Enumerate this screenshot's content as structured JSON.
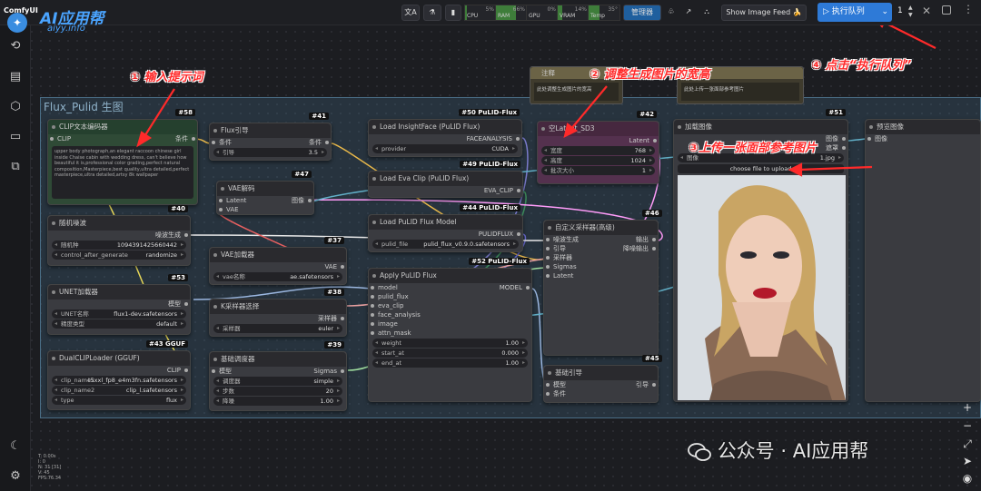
{
  "brand": {
    "comfy": "ComfyUI",
    "logo_text": "AI应用帮",
    "url": "aiyy.info",
    "sub": "se"
  },
  "topbar": {
    "translate": "文A",
    "monitor": {
      "cpu": {
        "label": "CPU",
        "val": "5%"
      },
      "ram": {
        "label": "RAM",
        "val": "66%"
      },
      "gpu": {
        "label": "GPU",
        "val": "0%"
      },
      "vram": {
        "label": "VRAM",
        "val": "14%"
      },
      "temp": {
        "label": "Temp",
        "val": "35°"
      }
    },
    "manager": "管理器",
    "show_feed": "Show Image Feed 🍌",
    "queue": "执行队列",
    "queue_count": "1"
  },
  "group_title": "Flux_Pulid 生图",
  "annotations": {
    "a1": "① 输入提示词",
    "a2": "② 调整生成图片的宽高",
    "a3": "③上传一张面部参考图片",
    "a4": "④ 点击“执行队列”"
  },
  "notes": [
    {
      "title": "注释",
      "body": "此处调整生成图片的宽高"
    },
    {
      "title": "",
      "body": "此处上传一张面部参考图片"
    }
  ],
  "nodes": {
    "clip": {
      "badge": "#58",
      "title": "CLIP文本编码器",
      "in": "CLIP",
      "out": "条件",
      "text": "upper body photograph,an elegant raccoon chinese girl inside Chaise cabin with wedding dress, can't believe how beautiful it is,professional color grading,perfect natural composition,Masterpiece,best quality,ultra detailed,perfect masterpiece,ultra detailed,artsy 8k wallpaper"
    },
    "guide": {
      "badge": "#41",
      "title": "Flux引导",
      "in": "条件",
      "out": "条件",
      "w_label": "引导",
      "w_val": "3.5"
    },
    "vaedec": {
      "badge": "#47",
      "title": "VAE解码",
      "in1": "Latent",
      "in2": "VAE",
      "out": "图像"
    },
    "noise": {
      "badge": "#40",
      "title": "随机噪波",
      "out": "噪波生成",
      "w1_label": "随机种",
      "w1_val": "1094391425660442",
      "w2_label": "control_after_generate",
      "w2_val": "randomize"
    },
    "vaeload": {
      "badge": "#37",
      "title": "VAE加载器",
      "out": "VAE",
      "w_label": "vae名称",
      "w_val": "ae.safetensors"
    },
    "unet": {
      "badge": "#53",
      "title": "UNET加载器",
      "out": "模型",
      "w1_label": "UNET名称",
      "w1_val": "flux1-dev.safetensors",
      "w2_label": "精度类型",
      "w2_val": "default"
    },
    "ksel": {
      "badge": "#38",
      "title": "K采样器选择",
      "out": "采样器",
      "w_label": "采样器",
      "w_val": "euler"
    },
    "dual": {
      "badge": "#43 GGUF",
      "title": "DualCLIPLoader (GGUF)",
      "out": "CLIP",
      "w1_label": "clip_name1",
      "w1_val": "t5xxl_fp8_e4m3fn.safetensors",
      "w2_label": "clip_name2",
      "w2_val": "clip_l.safetensors",
      "w3_label": "type",
      "w3_val": "flux"
    },
    "sched": {
      "badge": "#39",
      "title": "基础调度器",
      "in": "模型",
      "out": "Sigmas",
      "w1_label": "调度器",
      "w1_val": "simple",
      "w2_label": "步数",
      "w2_val": "20",
      "w3_label": "降噪",
      "w3_val": "1.00"
    },
    "insight": {
      "badge": "#50 PuLID-Flux",
      "title": "Load InsightFace (PuLID Flux)",
      "out": "FACEANALYSIS",
      "w_label": "provider",
      "w_val": "CUDA"
    },
    "eva": {
      "badge": "#49 PuLID-Flux",
      "title": "Load Eva Clip (PuLID Flux)",
      "out": "EVA_CLIP"
    },
    "pulidm": {
      "badge": "#44 PuLID-Flux",
      "title": "Load PuLID Flux Model",
      "out": "PULIDFLUX",
      "w_label": "pulid_file",
      "w_val": "pulid_flux_v0.9.0.safetensors"
    },
    "apply": {
      "badge": "#52 PuLID-Flux",
      "title": "Apply PuLID Flux",
      "ins": [
        "model",
        "pulid_flux",
        "eva_clip",
        "face_analysis",
        "image",
        "attn_mask"
      ],
      "out": "MODEL",
      "w1_label": "weight",
      "w1_val": "1.00",
      "w2_label": "start_at",
      "w2_val": "0.000",
      "w3_label": "end_at",
      "w3_val": "1.00"
    },
    "latent": {
      "badge": "#42",
      "title": "空Latent_SD3",
      "out": "Latent",
      "w1_label": "宽度",
      "w1_val": "768",
      "w2_label": "高度",
      "w2_val": "1024",
      "w3_label": "批次大小",
      "w3_val": "1"
    },
    "sampler": {
      "badge": "#46",
      "title": "自定义采样器(高级)",
      "ins": [
        "噪波生成",
        "引导",
        "采样器",
        "Sigmas",
        "Latent"
      ],
      "outs": [
        "输出",
        "降噪输出"
      ]
    },
    "basic": {
      "badge": "#45",
      "title": "基础引导",
      "in1": "模型",
      "in2": "条件",
      "out": "引导"
    },
    "loadimg": {
      "badge": "#51",
      "title": "加载图像",
      "outs": [
        "图像",
        "遮罩"
      ],
      "w_label": "图像",
      "w_val": "1.jpg",
      "upload": "choose file to upload"
    },
    "preview": {
      "title": "预览图像",
      "in": "图像"
    }
  },
  "stats": [
    "T: 0.00s",
    "I: 0",
    "N: 31 [31]",
    "V: 45",
    "FPS:76.34"
  ],
  "watermark": "公众号 · AI应用帮",
  "colors": {
    "accent": "#2e7ad7",
    "annotation": "#ff2a2a",
    "group": "#4a6e86"
  }
}
